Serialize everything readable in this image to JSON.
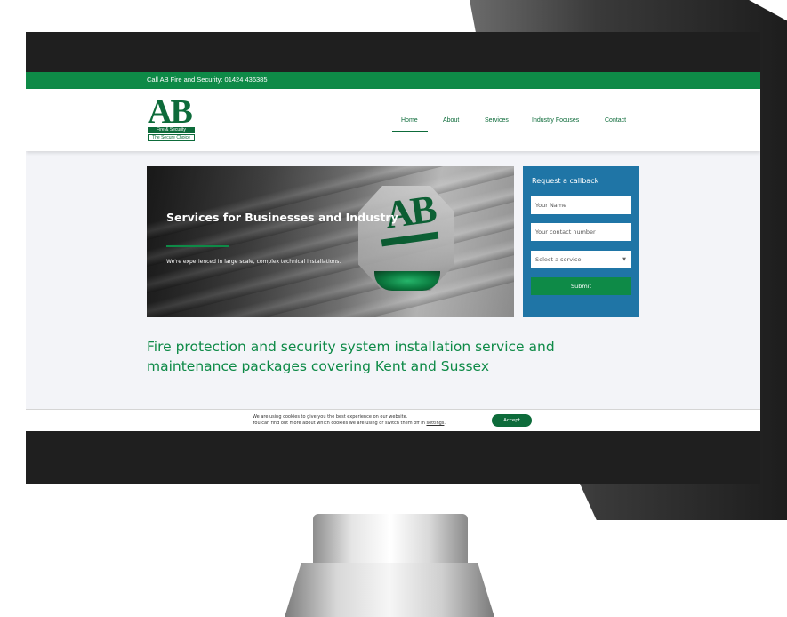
{
  "topbar": {
    "call_text": "Call AB Fire and Security: 01424 436385"
  },
  "logo": {
    "letters": "AB",
    "line1": "Fire & Security",
    "line2": "The Secure Choice"
  },
  "nav": {
    "items": [
      {
        "label": "Home",
        "active": true
      },
      {
        "label": "About"
      },
      {
        "label": "Services"
      },
      {
        "label": "Industry Focuses"
      },
      {
        "label": "Contact"
      }
    ]
  },
  "hero": {
    "title": "Services for Businesses and Industry",
    "subtitle": "We're experienced in large scale, complex technical installations."
  },
  "callback": {
    "heading": "Request a callback",
    "name_placeholder": "Your Name",
    "contact_placeholder": "Your contact number",
    "service_placeholder": "Select a service",
    "submit_label": "Submit"
  },
  "tagline": "Fire protection and security system installation service and maintenance packages covering Kent and Sussex",
  "cookie": {
    "line1": "We are using cookies to give you the best experience on our website.",
    "line2_prefix": "You can find out more about which cookies we are using or switch them off in ",
    "line2_link": "settings",
    "line2_suffix": ".",
    "accept_label": "Accept"
  },
  "colors": {
    "brand_green": "#0e8a47",
    "dark_green": "#0d6b3a",
    "callback_blue": "#1f75a6"
  }
}
